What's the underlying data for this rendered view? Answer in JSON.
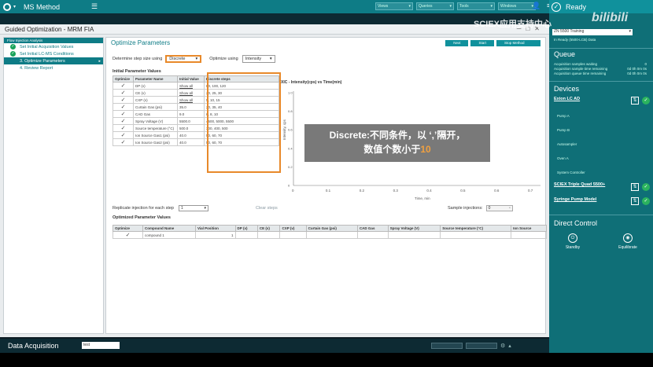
{
  "topbar": {
    "title": "MS Method",
    "dropdowns": [
      "Views",
      "Queries",
      "Tools",
      "Windows"
    ],
    "status": "Ready"
  },
  "window": {
    "title": "Guided Optimization - MRM FIA",
    "page_title": "Optimize Parameters",
    "buttons": [
      "Next",
      "Start",
      "Stop Method Optimization"
    ]
  },
  "leftnav": {
    "header": "Flow Injection Analysis",
    "steps": [
      {
        "label": "Set Initial Acquisition Values",
        "done": true
      },
      {
        "label": "Set Initial LC-MS Conditions",
        "done": true
      },
      {
        "label": "3. Optimize Parameters",
        "done": false,
        "active": true
      },
      {
        "label": "4. Review Report",
        "done": false
      }
    ]
  },
  "controls": {
    "step_label": "Determine step size using",
    "step_value": "Discrete",
    "optimize_label": "Optimize using",
    "optimize_value": "Intensity"
  },
  "initial_params": {
    "title": "Initial Parameter Values",
    "columns": [
      "Optimize",
      "Parameter Name",
      "Initial Value",
      "Discrete steps"
    ],
    "rows": [
      {
        "name": "DP (v)",
        "initial": "Show all",
        "steps": "80, 100, 120"
      },
      {
        "name": "CE (v)",
        "initial": "Show all",
        "steps": "20, 25, 30"
      },
      {
        "name": "CXP (v)",
        "initial": "Show all",
        "steps": "5, 10, 15"
      },
      {
        "name": "Curtain Gas (psi)",
        "initial": "35.0",
        "steps": "20, 35, 40"
      },
      {
        "name": "CAD Gas",
        "initial": "9.0",
        "steps": "6, 8, 10"
      },
      {
        "name": "Spray Voltage (V)",
        "initial": "5500.0",
        "steps": "4500, 5000, 5500"
      },
      {
        "name": "Source temperature (°C)",
        "initial": "500.0",
        "steps": "300, 400, 500"
      },
      {
        "name": "Ion Source Gas1 (psi)",
        "initial": "40.0",
        "steps": "50, 60, 70"
      },
      {
        "name": "Ion Source Gas2 (psi)",
        "initial": "40.0",
        "steps": "50, 60, 70"
      }
    ]
  },
  "xic": {
    "title": "XIC - Intensity(cps) vs Time(min)",
    "x_label": "Time, min",
    "y_label": "Intensity, cps",
    "x_ticks": [
      "0",
      "0.1",
      "0.2",
      "0.3",
      "0.4",
      "0.5",
      "0.6",
      "0.7"
    ],
    "y_ticks": [
      "1.0",
      "0.8",
      "0.6",
      "0.4",
      "0.2",
      "0"
    ]
  },
  "overlay": {
    "line1": "Discrete:不同条件，以 ‘,’隔开，",
    "line2_prefix": "数值个数小于",
    "line2_num": "10"
  },
  "replicate": {
    "label": "Replicate injection for each step",
    "value": "1",
    "link": "Clear steps",
    "samples_label": "Sample injections:",
    "samples_value": "0"
  },
  "optimized": {
    "title": "Optimized Parameter Values",
    "columns": [
      "Optimize",
      "Compound Name",
      "Vial Position",
      "DP (v)",
      "CE (v)",
      "CXP (v)",
      "Curtain Gas (psi)",
      "CAD Gas",
      "Spray Voltage (V)",
      "Source temperature (°C)",
      "Ion Source"
    ],
    "rows": [
      {
        "name": "compound 1",
        "vial": "1"
      }
    ]
  },
  "bottombar": {
    "label": "Data Acquisition",
    "input_value": "test"
  },
  "rpanel": {
    "instrument": "ZN 5500 Training",
    "instrument_sub": "In Ready (5500-LCB) Data",
    "queue_title": "Queue",
    "queue_rows": [
      {
        "k": "Acquisition samples waiting",
        "v": "0"
      },
      {
        "k": "Acquisition sample time remaining",
        "v": "0d 0h 0m 0s"
      },
      {
        "k": "Acquisition queue time remaining",
        "v": "0d 0h 0m 0s"
      }
    ],
    "devices_title": "Devices",
    "device1": "Exion LC AD",
    "device1_subs": [
      "Pump A",
      "Pump B",
      "Autosampler",
      "Oven A",
      "System Controller"
    ],
    "device2": "SCIEX Triple Quad 5500+",
    "device3": "Syringe Pump Model",
    "direct_title": "Direct Control",
    "btn_standby": "Standby",
    "btn_equilibrate": "Equilibrate"
  },
  "watermark": "SCIEX应用支持中心",
  "colors": {
    "accent": "#0e7c86",
    "highlight": "#e8892a",
    "ok": "#1aa35a"
  }
}
